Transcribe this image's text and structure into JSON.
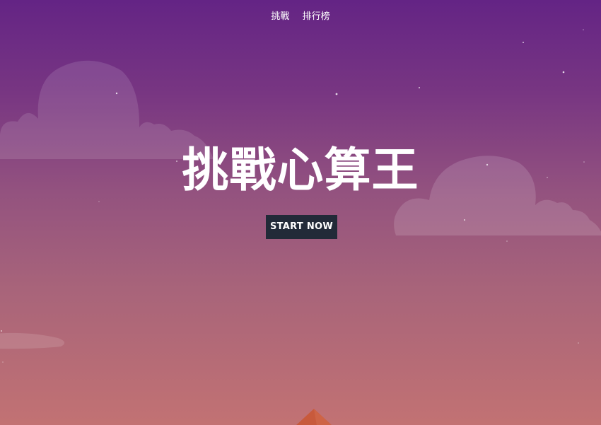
{
  "nav": {
    "items": [
      {
        "label": "挑戰"
      },
      {
        "label": "排行榜"
      }
    ]
  },
  "hero": {
    "title": "挑戰心算王",
    "cta_label": "START NOW"
  },
  "colors": {
    "sky_top": "#642485",
    "sky_bottom": "#c27273",
    "button_bg": "#222a38",
    "text": "#ffffff",
    "mountain": "#c85a3c"
  }
}
